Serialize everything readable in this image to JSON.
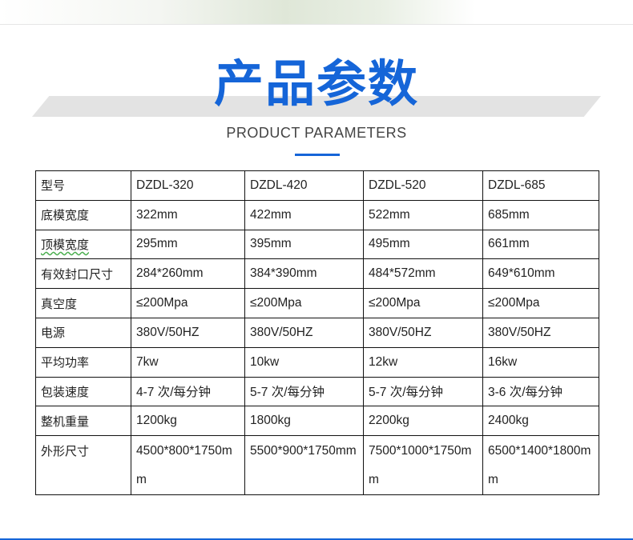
{
  "header": {
    "title": "产品参数",
    "subtitle": "PRODUCT PARAMETERS"
  },
  "colors": {
    "accent": "#1565d8",
    "table_border": "#111111",
    "stripe": "#e3e3e3"
  },
  "table": {
    "rows": [
      {
        "label": "型号",
        "values": [
          "DZDL-320",
          "DZDL-420",
          "DZDL-520",
          "DZDL-685"
        ]
      },
      {
        "label": "底模宽度",
        "values": [
          "322mm",
          "422mm",
          "522mm",
          "685mm"
        ]
      },
      {
        "label": "顶模宽度",
        "values": [
          "295mm",
          "395mm",
          "495mm",
          "661mm"
        ]
      },
      {
        "label": "有效封口尺寸",
        "values": [
          "284*260mm",
          "384*390mm",
          "484*572mm",
          "649*610mm"
        ]
      },
      {
        "label": "真空度",
        "values": [
          "≤200Mpa",
          "≤200Mpa",
          "≤200Mpa",
          "≤200Mpa"
        ]
      },
      {
        "label": "电源",
        "values": [
          "380V/50HZ",
          "380V/50HZ",
          "380V/50HZ",
          "380V/50HZ"
        ]
      },
      {
        "label": "平均功率",
        "values": [
          "7kw",
          "10kw",
          "12kw",
          "16kw"
        ]
      },
      {
        "label": "包装速度",
        "values": [
          "4-7 次/每分钟",
          "5-7 次/每分钟",
          "5-7 次/每分钟",
          "3-6 次/每分钟"
        ]
      },
      {
        "label": "整机重量",
        "values": [
          "1200kg",
          "1800kg",
          "2200kg",
          "2400kg"
        ]
      },
      {
        "label": "外形尺寸",
        "values": [
          "4500*800*1750mm",
          "5500*900*1750mm",
          "7500*1000*1750mm",
          "6500*1400*1800mm"
        ]
      }
    ]
  }
}
